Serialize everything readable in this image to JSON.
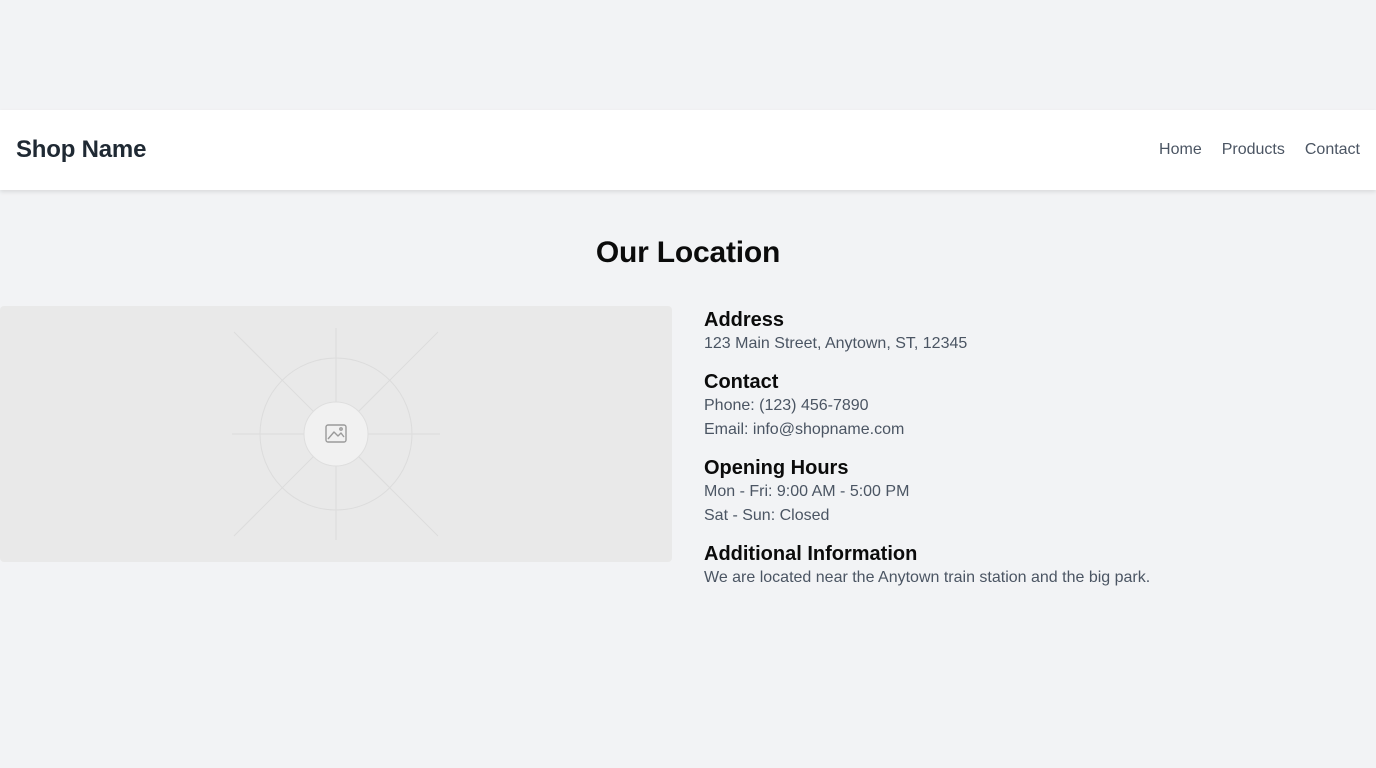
{
  "header": {
    "brand": "Shop Name",
    "nav": [
      "Home",
      "Products",
      "Contact"
    ]
  },
  "main": {
    "title": "Our Location",
    "image": {
      "icon": "image-placeholder-icon"
    },
    "sections": [
      {
        "heading": "Address",
        "lines": [
          "123 Main Street, Anytown, ST, 12345"
        ]
      },
      {
        "heading": "Contact",
        "lines": [
          "Phone: (123) 456-7890",
          "Email: info@shopname.com"
        ]
      },
      {
        "heading": "Opening Hours",
        "lines": [
          "Mon - Fri: 9:00 AM - 5:00 PM",
          "Sat - Sun: Closed"
        ]
      },
      {
        "heading": "Additional Information",
        "lines": [
          "We are located near the Anytown train station and the big park."
        ]
      }
    ]
  },
  "colors": {
    "background": "#f2f3f5",
    "navbar": "#ffffff",
    "text_primary": "#0b0b0b",
    "text_secondary": "#4b5563"
  }
}
